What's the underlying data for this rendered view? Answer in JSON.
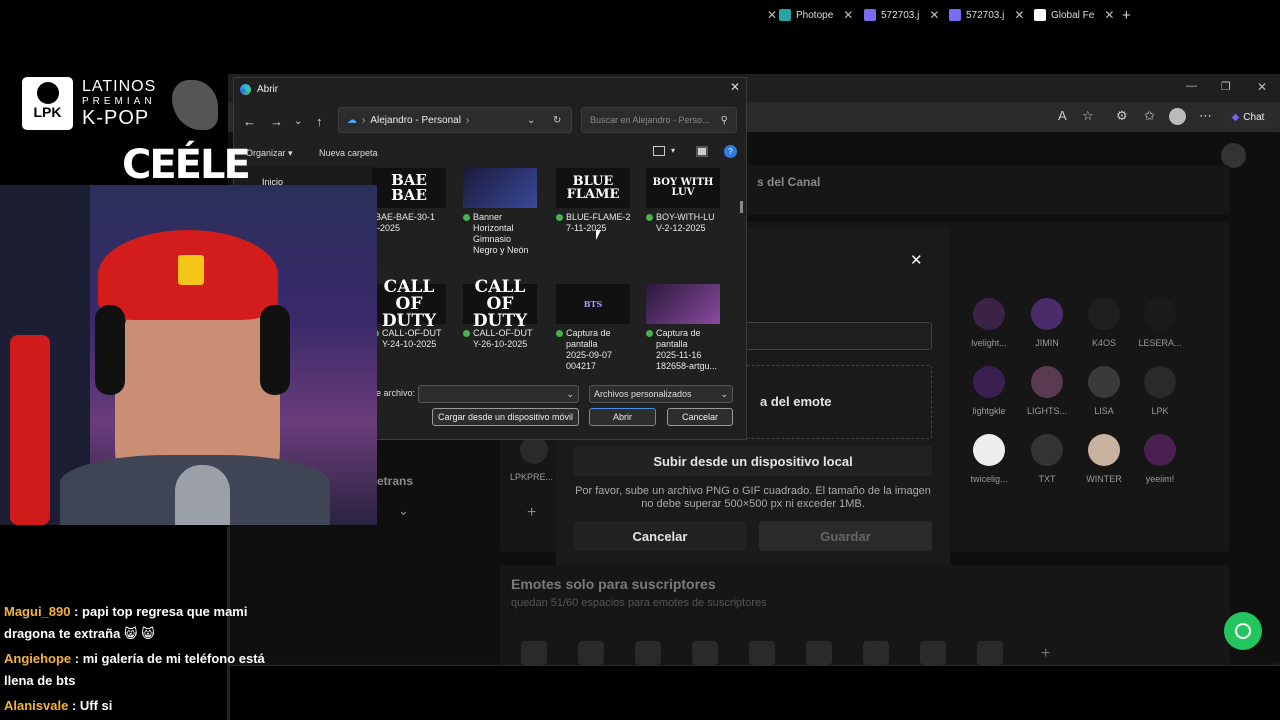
{
  "browser": {
    "tabs": [
      {
        "label": "Photope",
        "color": "#27a4a4"
      },
      {
        "label": "572703.j",
        "color": "#7a6cf0"
      },
      {
        "label": "572703.j",
        "color": "#7a6cf0"
      },
      {
        "label": "Global Fe",
        "color": "#ffffff"
      }
    ],
    "chat_label": "Chat",
    "channel_heading": "s del Canal"
  },
  "emote_modal": {
    "dropzone_text": "a del emote",
    "upload_local": "Subir desde un dispositivo local",
    "hint": "Por favor, sube un archivo PNG o GIF cuadrado. El tamaño de la imagen no debe superar 500×500 px ni exceder 1MB.",
    "cancel": "Cancelar",
    "save": "Guardar"
  },
  "emotes": [
    {
      "label": "lvelight..."
    },
    {
      "label": "JIMIN"
    },
    {
      "label": "K4OS"
    },
    {
      "label": "LESERA..."
    },
    {
      "label": "lightgkle"
    },
    {
      "label": "LIGHTS..."
    },
    {
      "label": "LISA"
    },
    {
      "label": "LPK"
    },
    {
      "label": "twicelig..."
    },
    {
      "label": "TXT"
    },
    {
      "label": "WINTER"
    },
    {
      "label": "yeeiim!"
    }
  ],
  "left_panel": {
    "lpk_label": "LPKPRE...",
    "etrans": "etrans"
  },
  "subs_section": {
    "title": "Emotes solo para suscriptores",
    "subtitle": "quedan 51/60 espacios para emotes de suscriptores"
  },
  "dialog": {
    "title": "Abrir",
    "path_label": "Alejandro - Personal",
    "search_placeholder": "Buscar en Alejandro - Perso...",
    "organize": "Organizar",
    "new_folder": "Nueva carpeta",
    "nav_item": "Inicio",
    "filename_label": "e archivo:",
    "filetype": "Archivos personalizados",
    "mobile_btn": "Cargar desde un dispositivo móvil",
    "open_btn": "Abrir",
    "cancel_btn": "Cancelar",
    "files": [
      {
        "thumb": "BAE BAE",
        "name": "-BAE-BAE-30-1\n0-2025",
        "dot": false
      },
      {
        "thumb": "",
        "name": "Banner\nHorizontal\nGimnasio\nNegro y Neón",
        "dot": true
      },
      {
        "thumb": "BLUE FLAME",
        "name": "BLUE-FLAME-2\n7-11-2025",
        "dot": true
      },
      {
        "thumb": "BOY WITH LUV",
        "name": "BOY-WITH-LU\nV-2-12-2025",
        "dot": true
      },
      {
        "thumb": "CALL OF\nDUTY",
        "name": "CALL-OF-DUT\nY-24-10-2025",
        "dot": true
      },
      {
        "thumb": "CALL OF\nDUTY",
        "name": "CALL-OF-DUT\nY-26-10-2025",
        "dot": true
      },
      {
        "thumb": "BTS",
        "name": "Captura de\npantalla\n2025-09-07\n004217",
        "dot": true
      },
      {
        "thumb": "",
        "name": "Captura de\npantalla\n2025-11-16\n182658-artgu...",
        "dot": true
      }
    ]
  },
  "overlay": {
    "logo_line1": "LATINOS",
    "logo_line2": "PREMIAN",
    "logo_line3": "K-POP",
    "logo_badge": "LPK",
    "cam_name": "CEÉLE"
  },
  "chat": [
    {
      "user": "Magui_890",
      "text": " : papi top regresa que mami dragona te extraña 😸 😸"
    },
    {
      "user": "Angiehope",
      "text": " : mi galería de mi teléfono está llena de bts"
    },
    {
      "user": "Alanisvale",
      "text": " : Uff si"
    }
  ]
}
